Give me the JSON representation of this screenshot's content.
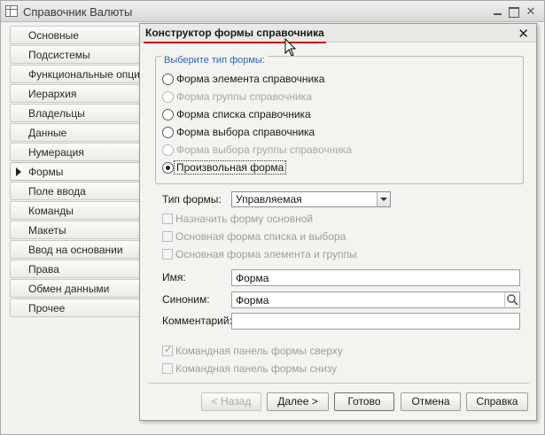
{
  "main_window": {
    "title": "Справочник Валюты"
  },
  "sidebar": {
    "items": [
      {
        "label": "Основные"
      },
      {
        "label": "Подсистемы"
      },
      {
        "label": "Функциональные опции"
      },
      {
        "label": "Иерархия"
      },
      {
        "label": "Владельцы"
      },
      {
        "label": "Данные"
      },
      {
        "label": "Нумерация"
      },
      {
        "label": "Формы"
      },
      {
        "label": "Поле ввода"
      },
      {
        "label": "Команды"
      },
      {
        "label": "Макеты"
      },
      {
        "label": "Ввод на основании"
      },
      {
        "label": "Права"
      },
      {
        "label": "Обмен данными"
      },
      {
        "label": "Прочее"
      }
    ],
    "active_index": 7
  },
  "dialog": {
    "title": "Конструктор формы справочника",
    "close_symbol": "✕",
    "form_type_group": {
      "legend": "Выберите тип формы:",
      "options": [
        {
          "label": "Форма элемента справочника",
          "enabled": true,
          "checked": false
        },
        {
          "label": "Форма группы справочника",
          "enabled": false,
          "checked": false
        },
        {
          "label": "Форма списка справочника",
          "enabled": true,
          "checked": false
        },
        {
          "label": "Форма выбора справочника",
          "enabled": true,
          "checked": false
        },
        {
          "label": "Форма выбора группы справочника",
          "enabled": false,
          "checked": false
        },
        {
          "label": "Произвольная форма",
          "enabled": true,
          "checked": true
        }
      ]
    },
    "form_kind": {
      "label": "Тип формы:",
      "value": "Управляемая"
    },
    "options_checkboxes": [
      {
        "label": "Назначить форму основной",
        "checked": false
      },
      {
        "label": "Основная форма списка и выбора",
        "checked": false
      },
      {
        "label": "Основная форма элемента и группы",
        "checked": false
      }
    ],
    "name": {
      "label": "Имя:",
      "value": "Форма"
    },
    "synonym": {
      "label": "Синоним:",
      "value": "Форма"
    },
    "comment": {
      "label": "Комментарий:",
      "value": ""
    },
    "panel_checkboxes": [
      {
        "label": "Командная панель формы сверху",
        "checked": true
      },
      {
        "label": "Командная панель формы снизу",
        "checked": false
      }
    ],
    "buttons": {
      "back": "< Назад",
      "next": "Далее >",
      "done": "Готово",
      "cancel": "Отмена",
      "help": "Справка"
    }
  },
  "colors": {
    "accent_underline": "#d40000",
    "legend_blue": "#2d66c0"
  }
}
